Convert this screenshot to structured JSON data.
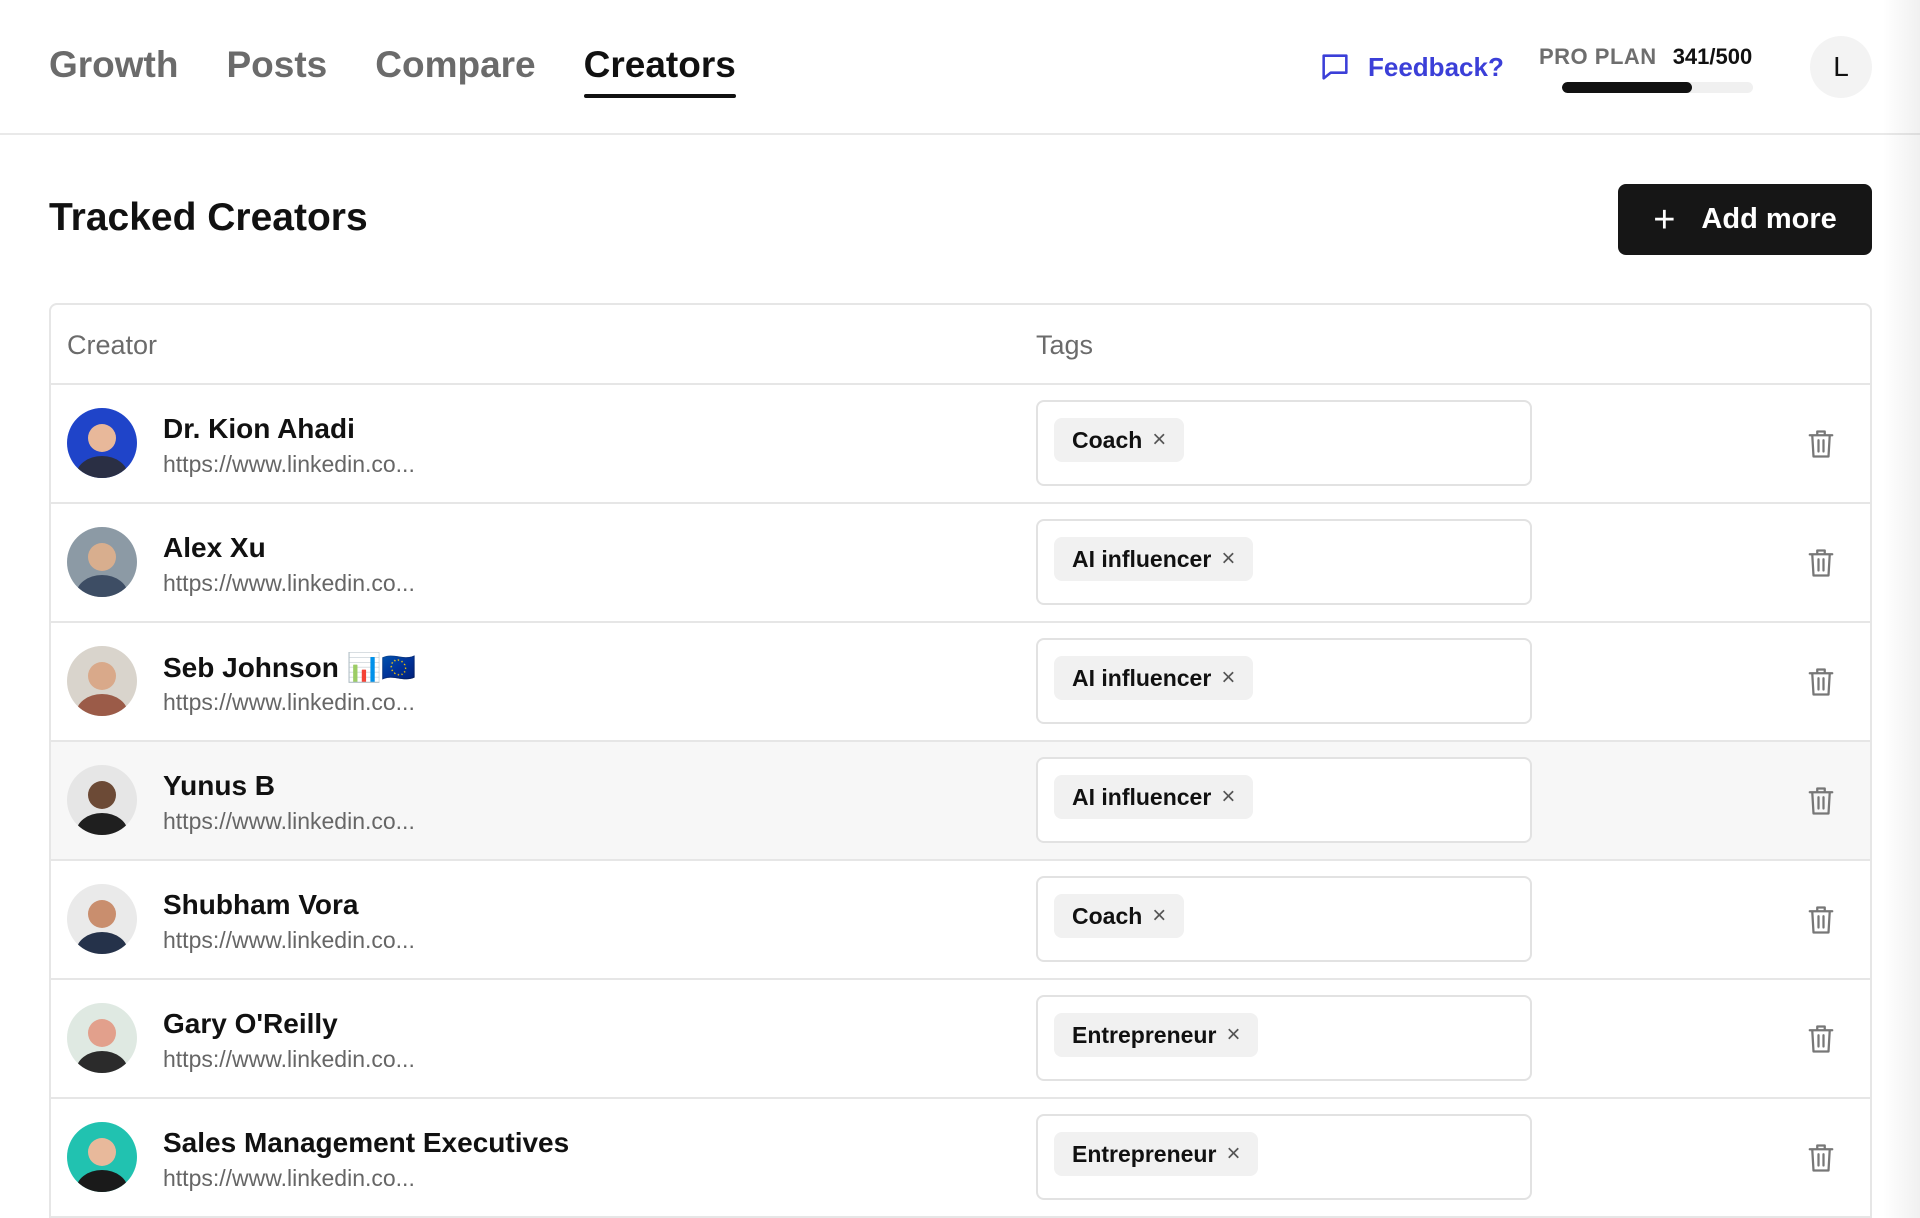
{
  "nav": {
    "tabs": [
      {
        "label": "Growth",
        "active": false
      },
      {
        "label": "Posts",
        "active": false
      },
      {
        "label": "Compare",
        "active": false
      },
      {
        "label": "Creators",
        "active": true
      }
    ]
  },
  "header": {
    "feedback_label": "Feedback?",
    "plan_label": "PRO PLAN",
    "plan_count": "341/500",
    "plan_usage_fraction": 0.682,
    "user_initial": "L"
  },
  "page": {
    "title": "Tracked Creators",
    "add_label": "Add more"
  },
  "table": {
    "columns": [
      "Creator",
      "Tags"
    ],
    "rows": [
      {
        "name": "Dr. Kion Ahadi",
        "url": "https://www.linkedin.co...",
        "tag": "Coach",
        "avatar": {
          "bg": "#1f44c9",
          "face": "#e8b89a",
          "body": "#2a2f44"
        }
      },
      {
        "name": "Alex Xu",
        "url": "https://www.linkedin.co...",
        "tag": "AI influencer",
        "avatar": {
          "bg": "#8c9aa5",
          "face": "#d8ae8e",
          "body": "#3d4d64"
        }
      },
      {
        "name": "Seb Johnson 📊🇪🇺",
        "url": "https://www.linkedin.co...",
        "tag": "AI influencer",
        "avatar": {
          "bg": "#d9d4cc",
          "face": "#d9a98a",
          "body": "#9b5b48"
        }
      },
      {
        "name": "Yunus B",
        "url": "https://www.linkedin.co...",
        "tag": "AI influencer",
        "hover": true,
        "avatar": {
          "bg": "#e6e6e6",
          "face": "#6c4a36",
          "body": "#1f1f1f"
        }
      },
      {
        "name": "Shubham Vora",
        "url": "https://www.linkedin.co...",
        "tag": "Coach",
        "avatar": {
          "bg": "#eaeaea",
          "face": "#c98e6e",
          "body": "#25324a"
        }
      },
      {
        "name": "Gary O'Reilly",
        "url": "https://www.linkedin.co...",
        "tag": "Entrepreneur",
        "avatar": {
          "bg": "#dfe9e2",
          "face": "#e2a08c",
          "body": "#2b2b2b"
        }
      },
      {
        "name": "Sales Management Executives",
        "url": "https://www.linkedin.co...",
        "tag": "Entrepreneur",
        "avatar": {
          "bg": "#21c2b0",
          "face": "#e8b99b",
          "body": "#1a1a1a"
        }
      }
    ]
  },
  "colors": {
    "accent": "#3b3fd8",
    "primary_button": "#161616"
  }
}
